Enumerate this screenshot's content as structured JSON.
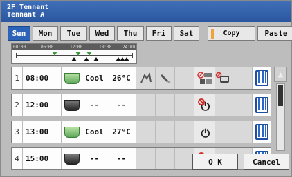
{
  "header": {
    "line1": "2F Tennant",
    "line2": "Tennant A"
  },
  "days": [
    "Sun",
    "Mon",
    "Tue",
    "Wed",
    "Thu",
    "Fri",
    "Sat"
  ],
  "active_day": "Sun",
  "buttons": {
    "copy": "Copy",
    "paste": "Paste",
    "ok": "O K",
    "cancel": "Cancel"
  },
  "timeline": {
    "ticks": [
      "00:00",
      "06:00",
      "12:00",
      "18:00",
      "24:00"
    ]
  },
  "rows": [
    {
      "num": "1",
      "time": "08:00",
      "fan": "fan-green",
      "mode": "Cool",
      "temp": "26°C",
      "power": "",
      "icons": [
        "fan-speed-icon",
        "vane-icon",
        "prohibit-icon",
        "setback-icon"
      ]
    },
    {
      "num": "2",
      "time": "12:00",
      "fan": "fan-dark",
      "mode": "--",
      "temp": "--",
      "power": "off-prohibit",
      "icons": []
    },
    {
      "num": "3",
      "time": "13:00",
      "fan": "fan-green",
      "mode": "Cool",
      "temp": "27°C",
      "power": "on",
      "icons": []
    },
    {
      "num": "4",
      "time": "15:00",
      "fan": "fan-dark",
      "mode": "--",
      "temp": "--",
      "power": "off-prohibit",
      "icons": []
    }
  ],
  "colors": {
    "header": "#2a56a0",
    "active_tab": "#2c63b8",
    "trash": "#1f4fa0",
    "prohibit": "#d43030",
    "timeline_on": "#3c9a3c"
  }
}
